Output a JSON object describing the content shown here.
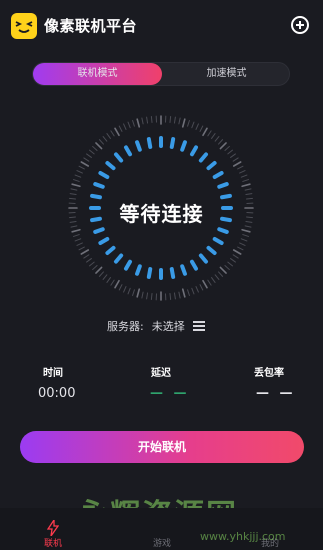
{
  "header": {
    "title": "像素联机平台",
    "logo_icon": "smiley-logo-icon",
    "add_icon": "plus-circle-icon"
  },
  "mode_switch": {
    "tabs": [
      {
        "label": "联机模式",
        "active": true
      },
      {
        "label": "加速模式",
        "active": false
      }
    ]
  },
  "dial": {
    "status": "等待连接",
    "accent_color": "#3a9be6"
  },
  "server": {
    "label": "服务器:",
    "value": "未选择",
    "icon": "server-list-icon"
  },
  "stats": {
    "time": {
      "label": "时间",
      "value": "00:00"
    },
    "latency": {
      "label": "延迟",
      "value": "— —"
    },
    "packet_loss": {
      "label": "丢包率",
      "value": "— —"
    }
  },
  "start_button": {
    "label": "开始联机"
  },
  "bottom_nav": {
    "items": [
      {
        "label": "联机",
        "icon": "lightning-icon",
        "active": true
      },
      {
        "label": "游戏",
        "icon": "gamepad-icon",
        "active": false
      },
      {
        "label": "我的",
        "icon": "user-icon",
        "active": false
      }
    ]
  },
  "watermark": {
    "text": "永辉资源网",
    "url": "www.yhkjjj.com"
  }
}
